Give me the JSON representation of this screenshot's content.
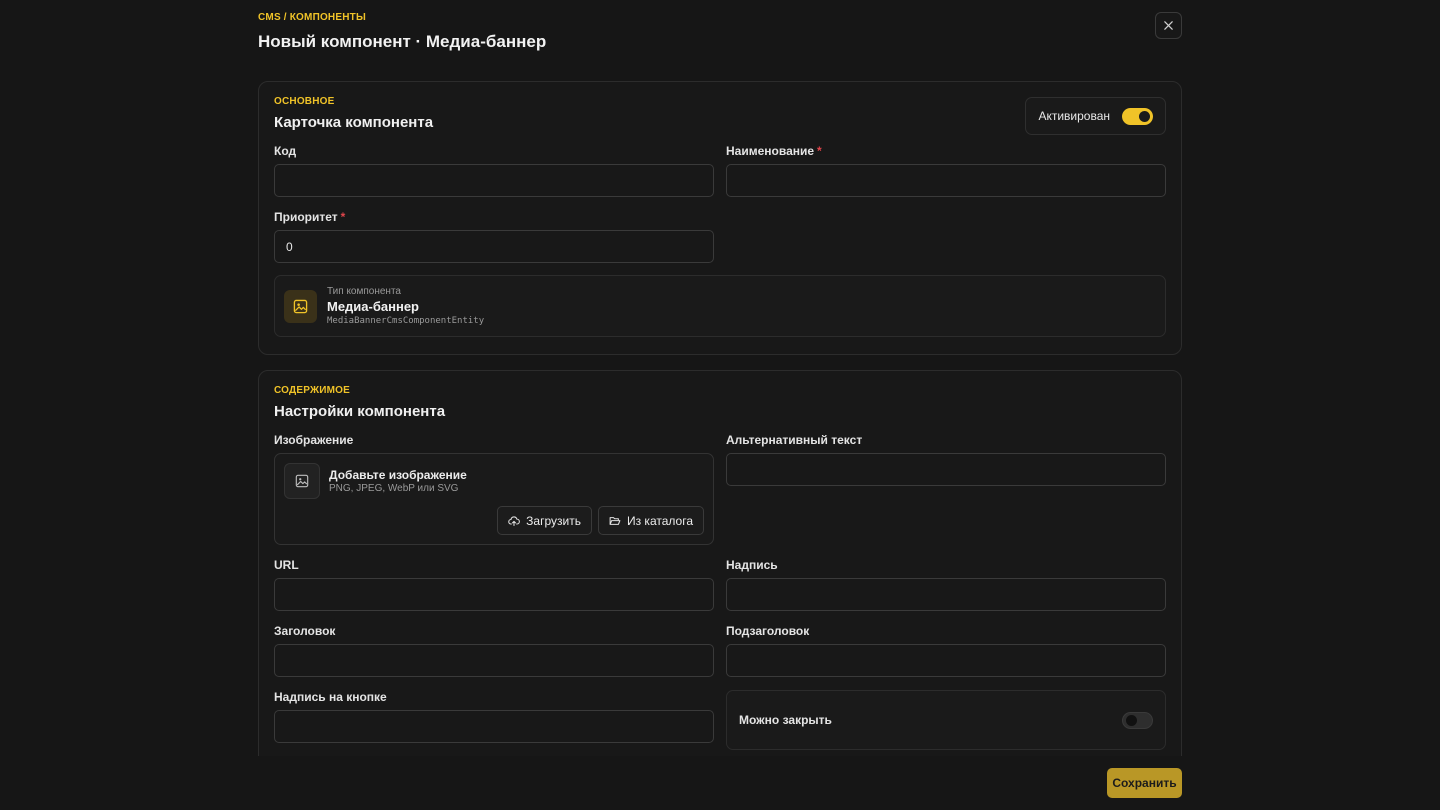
{
  "header": {
    "breadcrumb": "CMS / КОМПОНЕНТЫ",
    "title": "Новый компонент · Медиа-баннер",
    "close_icon": "close-icon"
  },
  "basic": {
    "tag": "ОСНОВНОЕ",
    "title": "Карточка компонента",
    "active_label": "Активирован",
    "active": true,
    "code_label": "Код",
    "code_value": "",
    "name_label": "Наименование",
    "name_value": "",
    "priority_label": "Приоритет",
    "priority_value": "0",
    "required_mark": "*",
    "type_caption": "Тип компонента",
    "type_name": "Медиа-баннер",
    "type_class": "MediaBannerCmsComponentEntity"
  },
  "content": {
    "tag": "СОДЕРЖИМОЕ",
    "title": "Настройки компонента",
    "image_label": "Изображение",
    "upload_title": "Добавьте изображение",
    "upload_hint": "PNG, JPEG, WebP или SVG",
    "upload_button": "Загрузить",
    "catalog_button": "Из каталога",
    "alt_label": "Альтернативный текст",
    "url_label": "URL",
    "caption_label": "Надпись",
    "heading_label": "Заголовок",
    "subheading_label": "Подзаголовок",
    "button_text_label": "Надпись на кнопке",
    "closable_label": "Можно закрыть",
    "closable": false
  },
  "footer": {
    "save_label": "Сохранить"
  },
  "colors": {
    "accent": "#f0c328",
    "background": "#161616",
    "required": "#e0454b"
  }
}
